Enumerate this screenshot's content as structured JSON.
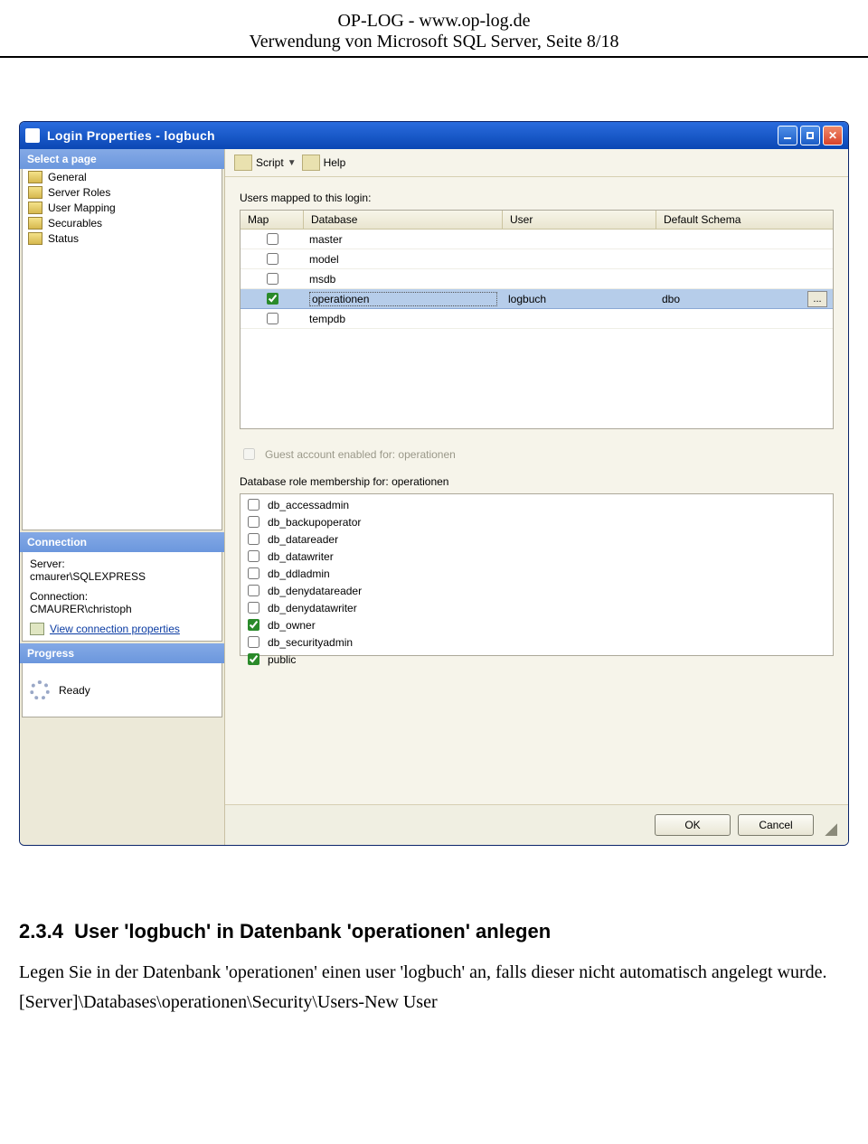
{
  "doc": {
    "header_line1": "OP-LOG - www.op-log.de",
    "header_line2": "Verwendung von Microsoft SQL Server, Seite 8/18",
    "section_num": "2.3.4",
    "section_title": "User 'logbuch' in Datenbank 'operationen' anlegen",
    "para1": "Legen Sie in der Datenbank 'operationen' einen user 'logbuch' an, falls dieser nicht automatisch angelegt wurde.",
    "para2": "[Server]\\Databases\\operationen\\Security\\Users-New User"
  },
  "window": {
    "title": "Login Properties - logbuch",
    "sidebar": {
      "select_page": "Select a page",
      "pages": [
        "General",
        "Server Roles",
        "User Mapping",
        "Securables",
        "Status"
      ],
      "connection_head": "Connection",
      "server_label": "Server:",
      "server_value": "cmaurer\\SQLEXPRESS",
      "conn_label": "Connection:",
      "conn_value": "CMAURER\\christoph",
      "view_link": "View connection properties",
      "progress_head": "Progress",
      "progress_value": "Ready"
    },
    "toolbar": {
      "script": "Script",
      "help": "Help"
    },
    "main": {
      "mapped_label": "Users mapped to this login:",
      "cols": {
        "map": "Map",
        "db": "Database",
        "usr": "User",
        "sch": "Default Schema"
      },
      "rows": [
        {
          "map": false,
          "db": "master",
          "usr": "",
          "sch": ""
        },
        {
          "map": false,
          "db": "model",
          "usr": "",
          "sch": ""
        },
        {
          "map": false,
          "db": "msdb",
          "usr": "",
          "sch": ""
        },
        {
          "map": true,
          "db": "operationen",
          "usr": "logbuch",
          "sch": "dbo",
          "selected": true
        },
        {
          "map": false,
          "db": "tempdb",
          "usr": "",
          "sch": ""
        }
      ],
      "guest_label": "Guest account enabled for: operationen",
      "roles_label": "Database role membership for: operationen",
      "roles": [
        {
          "name": "db_accessadmin",
          "checked": false
        },
        {
          "name": "db_backupoperator",
          "checked": false
        },
        {
          "name": "db_datareader",
          "checked": false
        },
        {
          "name": "db_datawriter",
          "checked": false
        },
        {
          "name": "db_ddladmin",
          "checked": false
        },
        {
          "name": "db_denydatareader",
          "checked": false
        },
        {
          "name": "db_denydatawriter",
          "checked": false
        },
        {
          "name": "db_owner",
          "checked": true
        },
        {
          "name": "db_securityadmin",
          "checked": false
        },
        {
          "name": "public",
          "checked": true
        }
      ]
    },
    "buttons": {
      "ok": "OK",
      "cancel": "Cancel",
      "ellipsis": "..."
    }
  }
}
